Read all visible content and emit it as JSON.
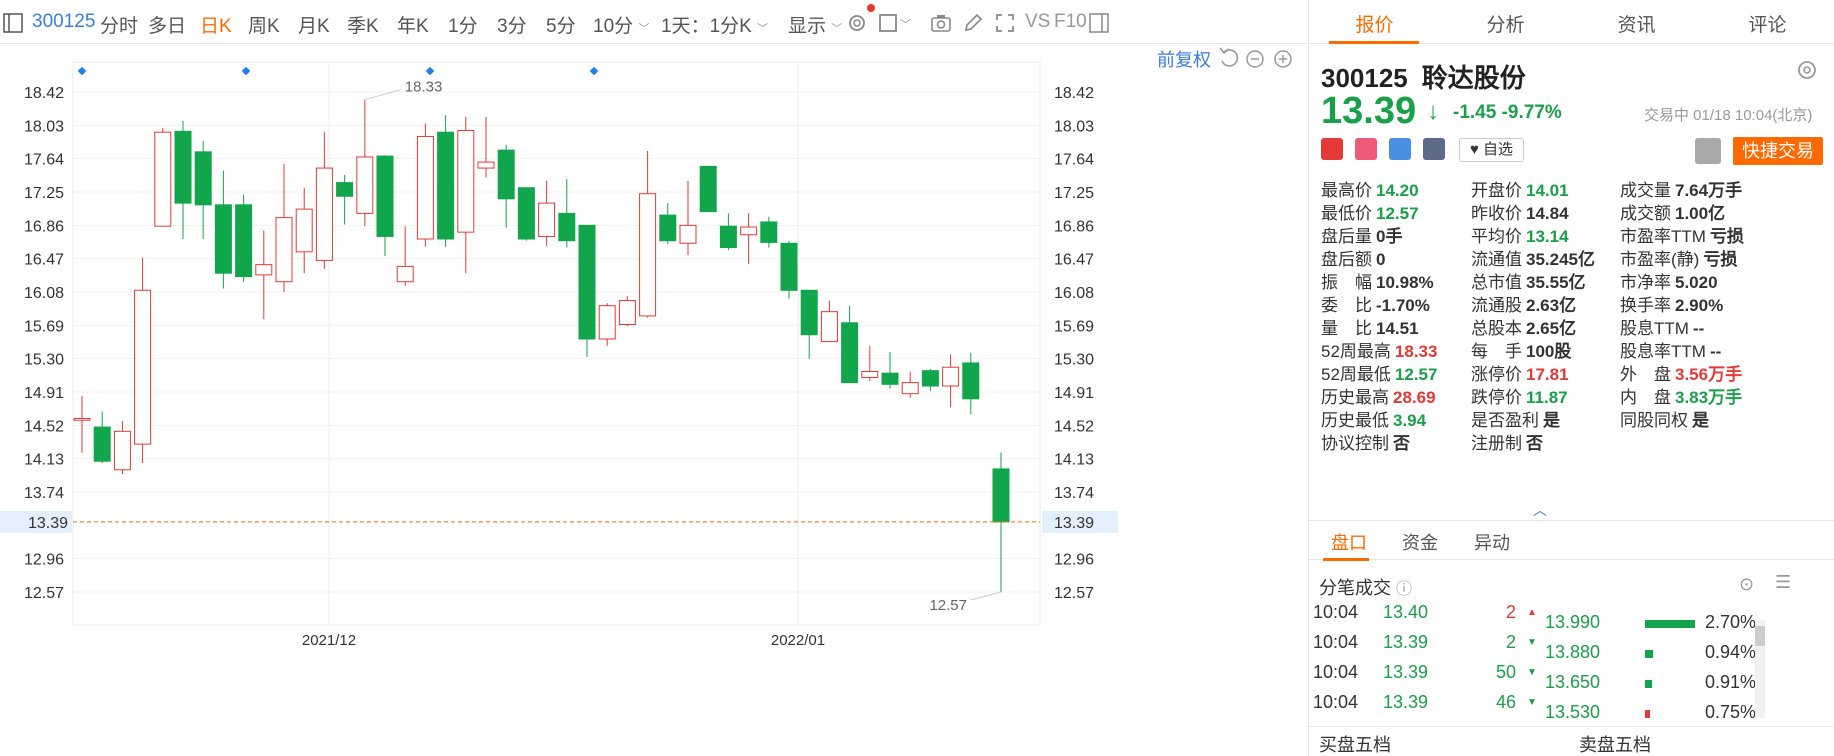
{
  "toolbar": {
    "code": "300125",
    "items": [
      "分时",
      "多日",
      "日K",
      "周K",
      "月K",
      "季K",
      "年K",
      "1分",
      "3分",
      "5分",
      "10分"
    ],
    "active": "日K",
    "period_select": "1天：1分K",
    "display": "显示",
    "vs": "VS",
    "f10": "F10"
  },
  "chart": {
    "restore": "前复权",
    "dates": [
      "2021/12",
      "2022/01"
    ],
    "price_labels": [
      "18.42",
      "18.03",
      "17.64",
      "17.25",
      "16.86",
      "16.47",
      "16.08",
      "15.69",
      "15.30",
      "14.91",
      "14.52",
      "14.13",
      "13.74",
      "13.39",
      "12.96",
      "12.57"
    ],
    "high_label": "18.33",
    "low_label": "12.57",
    "current": "13.39",
    "colors": {
      "up": "#e53935",
      "down": "#12a64c",
      "accent": "#ff6a00",
      "grid": "#eeeeee"
    }
  },
  "chart_data": {
    "type": "candlestick",
    "ylim": [
      12.4,
      18.6
    ],
    "current_price": 13.39,
    "x_labels": [
      "2021/12",
      "2022/01"
    ],
    "candles": [
      [
        14.58,
        14.6,
        14.86,
        14.2
      ],
      [
        14.5,
        14.1,
        14.68,
        14.08
      ],
      [
        14.0,
        14.45,
        14.57,
        13.95
      ],
      [
        14.3,
        16.1,
        16.48,
        14.08
      ],
      [
        16.85,
        17.95,
        18.0,
        16.85
      ],
      [
        17.96,
        17.12,
        18.08,
        16.7
      ],
      [
        17.72,
        17.1,
        17.85,
        16.7
      ],
      [
        17.1,
        16.3,
        17.5,
        16.12
      ],
      [
        17.1,
        16.26,
        17.22,
        16.2
      ],
      [
        16.28,
        16.4,
        16.8,
        15.76
      ],
      [
        16.2,
        16.95,
        17.58,
        16.08
      ],
      [
        16.55,
        17.05,
        17.3,
        16.3
      ],
      [
        16.45,
        17.53,
        17.95,
        16.35
      ],
      [
        17.36,
        17.2,
        17.45,
        16.87
      ],
      [
        17.0,
        17.66,
        18.33,
        16.85
      ],
      [
        17.67,
        16.73,
        17.68,
        16.5
      ],
      [
        16.2,
        16.38,
        16.85,
        16.15
      ],
      [
        16.7,
        17.9,
        18.05,
        16.61
      ],
      [
        17.95,
        16.7,
        18.15,
        16.61
      ],
      [
        16.78,
        17.97,
        18.13,
        16.3
      ],
      [
        17.53,
        17.6,
        18.13,
        17.42
      ],
      [
        17.74,
        17.17,
        17.8,
        16.83
      ],
      [
        17.3,
        16.7,
        17.3,
        16.68
      ],
      [
        16.73,
        17.12,
        17.38,
        16.62
      ],
      [
        17.0,
        16.68,
        17.4,
        16.6
      ],
      [
        16.86,
        15.53,
        16.86,
        15.32
      ],
      [
        15.53,
        15.92,
        15.95,
        15.45
      ],
      [
        15.7,
        15.98,
        16.03,
        15.68
      ],
      [
        15.8,
        17.23,
        17.73,
        15.78
      ],
      [
        16.98,
        16.68,
        17.12,
        16.64
      ],
      [
        16.65,
        16.86,
        17.38,
        16.51
      ],
      [
        17.55,
        17.02,
        17.55,
        17.02
      ],
      [
        16.85,
        16.6,
        17.0,
        16.57
      ],
      [
        16.75,
        16.84,
        17.0,
        16.41
      ],
      [
        16.9,
        16.66,
        16.96,
        16.6
      ],
      [
        16.65,
        16.1,
        16.68,
        16.0
      ],
      [
        16.1,
        15.58,
        16.08,
        15.3
      ],
      [
        15.5,
        15.85,
        15.98,
        15.5
      ],
      [
        15.72,
        15.02,
        15.92,
        15.05
      ],
      [
        15.08,
        15.15,
        15.45,
        15.04
      ],
      [
        15.13,
        15.0,
        15.38,
        14.95
      ],
      [
        14.89,
        15.02,
        15.15,
        14.84
      ],
      [
        15.16,
        14.98,
        15.18,
        14.92
      ],
      [
        14.98,
        15.2,
        15.35,
        14.73
      ],
      [
        15.25,
        14.83,
        15.37,
        14.65
      ],
      [
        14.01,
        13.39,
        14.2,
        12.57
      ]
    ]
  },
  "panel": {
    "tabs": [
      "报价",
      "分析",
      "资讯",
      "评论"
    ],
    "active_tab": "报价",
    "code": "300125",
    "name": "聆达股份",
    "price": "13.39",
    "arrow": "↓",
    "change": "-1.45",
    "change_pct": "-9.77%",
    "status": "交易中 01/18 10:04(北京)",
    "watch": "自选",
    "trade": "快捷交易",
    "stats": [
      [
        "最高价",
        "14.20",
        "green"
      ],
      [
        "开盘价",
        "14.01",
        "green"
      ],
      [
        "成交量",
        "7.64万手",
        ""
      ],
      [
        "最低价",
        "12.57",
        "green"
      ],
      [
        "昨收价",
        "14.84",
        ""
      ],
      [
        "成交额",
        "1.00亿",
        ""
      ],
      [
        "盘后量",
        "0手",
        ""
      ],
      [
        "平均价",
        "13.14",
        "green"
      ],
      [
        "市盈率TTM",
        "亏损",
        ""
      ],
      [
        "盘后额",
        "0",
        ""
      ],
      [
        "流通值",
        "35.245亿",
        ""
      ],
      [
        "市盈率(静)",
        "亏损",
        ""
      ],
      [
        "振　幅",
        "10.98%",
        ""
      ],
      [
        "总市值",
        "35.55亿",
        ""
      ],
      [
        "市净率",
        "5.020",
        ""
      ],
      [
        "委　比",
        "-1.70%",
        ""
      ],
      [
        "流通股",
        "2.63亿",
        ""
      ],
      [
        "换手率",
        "2.90%",
        ""
      ],
      [
        "量　比",
        "14.51",
        ""
      ],
      [
        "总股本",
        "2.65亿",
        ""
      ],
      [
        "股息TTM",
        "--",
        ""
      ],
      [
        "52周最高",
        "18.33",
        "red"
      ],
      [
        "每　手",
        "100股",
        ""
      ],
      [
        "股息率TTM",
        "--",
        ""
      ],
      [
        "52周最低",
        "12.57",
        "green"
      ],
      [
        "涨停价",
        "17.81",
        "red"
      ],
      [
        "外　盘",
        "3.56万手",
        "red"
      ],
      [
        "历史最高",
        "28.69",
        "red"
      ],
      [
        "跌停价",
        "11.87",
        "green"
      ],
      [
        "内　盘",
        "3.83万手",
        "green"
      ],
      [
        "历史最低",
        "3.94",
        "green"
      ],
      [
        "是否盈利",
        "是",
        ""
      ],
      [
        "同股同权",
        "是",
        ""
      ],
      [
        "协议控制",
        "否",
        ""
      ],
      [
        "注册制",
        "否",
        ""
      ]
    ],
    "subtabs": [
      "盘口",
      "资金",
      "异动"
    ],
    "tick_title": "分笔成交",
    "ticks": [
      [
        "10:04",
        "13.40",
        "2",
        "up"
      ],
      [
        "10:04",
        "13.39",
        "2",
        "down"
      ],
      [
        "10:04",
        "13.39",
        "50",
        "down"
      ],
      [
        "10:04",
        "13.39",
        "46",
        "down"
      ]
    ],
    "book": [
      [
        "13.990",
        "2.70%",
        "green",
        100
      ],
      [
        "13.880",
        "0.94%",
        "green",
        15
      ],
      [
        "13.650",
        "0.91%",
        "green",
        14
      ],
      [
        "13.530",
        "0.75%",
        "red",
        9
      ]
    ],
    "bottom": [
      "买盘五档",
      "卖盘五档"
    ]
  }
}
